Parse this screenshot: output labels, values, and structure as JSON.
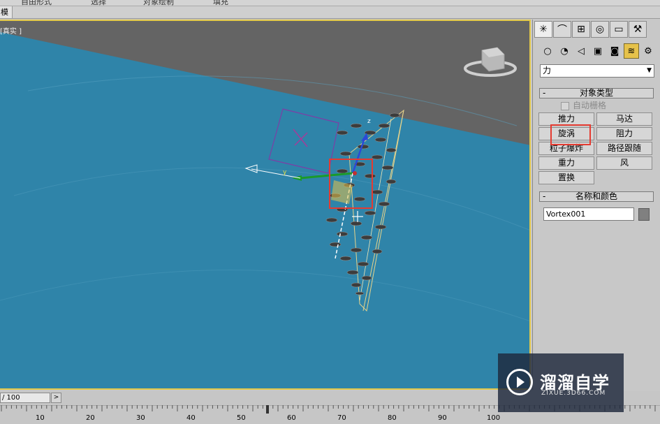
{
  "top_menu": {
    "items": [
      "自由形式",
      "选择",
      "对象绘制",
      "填充"
    ]
  },
  "menu_tab": {
    "label": "模"
  },
  "viewport": {
    "label": "[真实 ]",
    "axis_labels": {
      "y": "y",
      "z": "z"
    },
    "colors": {
      "background": "#2f84a9",
      "border": "#e3c94a",
      "ground": "#646464"
    }
  },
  "panel": {
    "tabs": [
      "create-icon",
      "modify-icon",
      "hierarchy-icon",
      "motion-icon",
      "display-icon",
      "utilities-icon"
    ],
    "sub_icons": [
      "geometry-icon",
      "shapes-icon",
      "lights-icon",
      "cameras-icon",
      "helpers-icon",
      "spacewarps-icon",
      "systems-icon"
    ],
    "dropdown_value": "力",
    "object_type": {
      "title": "对象类型",
      "autogrid_label": "自动栅格",
      "buttons": [
        "推力",
        "马达",
        "旋涡",
        "阻力",
        "粒子爆炸",
        "路径跟随",
        "重力",
        "风",
        "置换"
      ]
    },
    "name_color": {
      "title": "名称和颜色",
      "name_value": "Vortex001",
      "color": "#808080"
    }
  },
  "timeline": {
    "frame_counter": "/ 100",
    "next_label": ">",
    "ruler_labels": [
      "10",
      "20",
      "30",
      "40",
      "50",
      "60",
      "70",
      "80",
      "90",
      "100"
    ]
  },
  "watermark": {
    "main": "溜溜自学",
    "sub": "ZIXUE.3D66.COM"
  }
}
